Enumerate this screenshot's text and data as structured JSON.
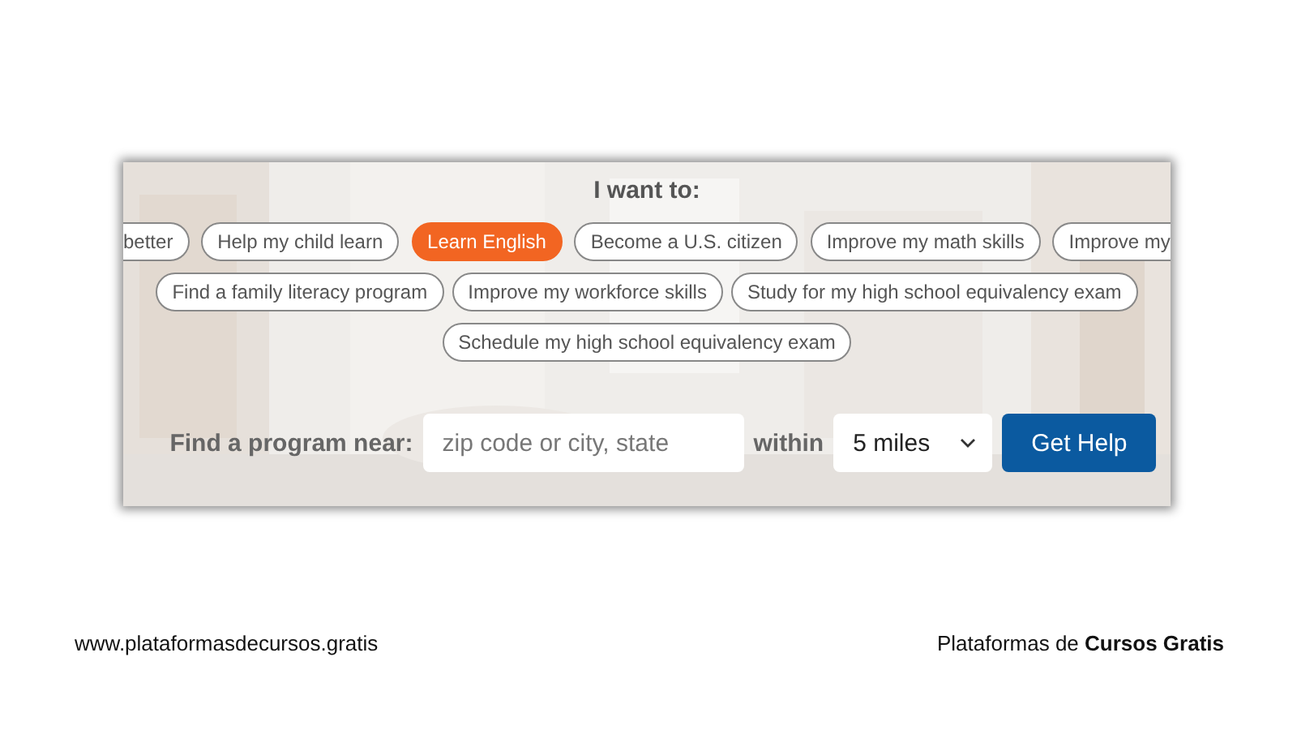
{
  "panel": {
    "heading": "I want to:",
    "chip_rows": [
      [
        {
          "label": "better",
          "selected": false,
          "kind": "cut_left"
        },
        {
          "label": "Help my child learn",
          "selected": false,
          "kind": "chip"
        },
        {
          "label": "Learn English",
          "selected": true,
          "kind": "chip"
        },
        {
          "label": "Become a U.S. citizen",
          "selected": false,
          "kind": "chip"
        },
        {
          "label": "Improve my math skills",
          "selected": false,
          "kind": "chip"
        },
        {
          "label": "Improve my",
          "selected": false,
          "kind": "cut_right"
        }
      ],
      [
        {
          "label": "Find a family literacy program",
          "selected": false,
          "kind": "chip"
        },
        {
          "label": "Improve my workforce skills",
          "selected": false,
          "kind": "chip"
        },
        {
          "label": "Study for my high school equivalency exam",
          "selected": false,
          "kind": "chip"
        }
      ],
      [
        {
          "label": "Schedule my high school equivalency exam",
          "selected": false,
          "kind": "chip"
        }
      ]
    ],
    "search": {
      "label": "Find a program near:",
      "placeholder": "zip code or city, state",
      "within_label": "within",
      "distance": "5 miles",
      "button": "Get Help"
    }
  },
  "footer": {
    "left": "www.plataformasdecursos.gratis",
    "right": "Plataformas de **Cursos Gratis**"
  }
}
